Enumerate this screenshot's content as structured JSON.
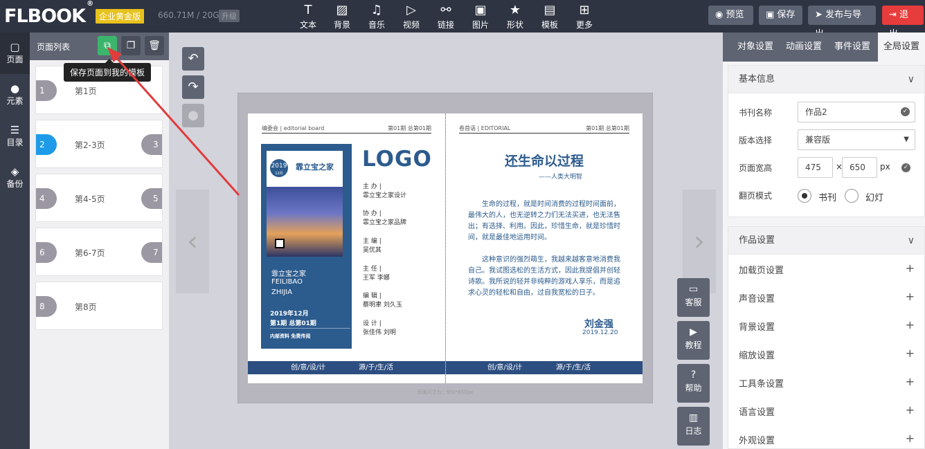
{
  "topbar": {
    "logo": "FLBOOK",
    "logo_mark": "®",
    "edition": "企业黄金版",
    "storage": "660.71M / 20G",
    "upgrade": "升级",
    "tools": [
      {
        "label": "文本",
        "icon": "text-icon",
        "glyph": "T"
      },
      {
        "label": "背景",
        "icon": "background-icon",
        "glyph": "▨"
      },
      {
        "label": "音乐",
        "icon": "music-icon",
        "glyph": "♫"
      },
      {
        "label": "视频",
        "icon": "video-icon",
        "glyph": "▷"
      },
      {
        "label": "链接",
        "icon": "link-icon",
        "glyph": "⚯"
      },
      {
        "label": "图片",
        "icon": "image-icon",
        "glyph": "▣"
      },
      {
        "label": "形状",
        "icon": "star-icon",
        "glyph": "★"
      },
      {
        "label": "模板",
        "icon": "template-icon",
        "glyph": "▤"
      },
      {
        "label": "更多",
        "icon": "more-icon",
        "glyph": "⊞"
      }
    ],
    "preview": "预览",
    "save": "保存",
    "publish": "发布与导出",
    "logout": "退出"
  },
  "leftnav": [
    {
      "label": "页面",
      "icon": "page-icon",
      "glyph": "▢"
    },
    {
      "label": "元素",
      "icon": "element-icon",
      "glyph": "●"
    },
    {
      "label": "目录",
      "icon": "catalog-icon",
      "glyph": "☰"
    },
    {
      "label": "备份",
      "icon": "backup-icon",
      "glyph": "◈"
    }
  ],
  "pagelist": {
    "title": "页面列表",
    "tooltip": "保存页面到我的模板",
    "pages": [
      {
        "label": "第1页",
        "left": "1",
        "right": ""
      },
      {
        "label": "第2-3页",
        "left": "2",
        "right": "3"
      },
      {
        "label": "第4-5页",
        "left": "4",
        "right": "5"
      },
      {
        "label": "第6-7页",
        "left": "6",
        "right": "7"
      },
      {
        "label": "第8页",
        "left": "8",
        "right": ""
      }
    ]
  },
  "book": {
    "caption": "页面尺寸为：950*650px",
    "left": {
      "head_left": "编委会 | editorial board",
      "head_right": "第01期 总第01期",
      "cover_title": "霏立宝之家",
      "cover_year": "2019",
      "cover_month": "12月",
      "cover_name_cn": "霏立宝之家",
      "cover_name_en1": "FEILIBAO",
      "cover_name_en2": "ZHIJIA",
      "cover_date": "2019年12月",
      "cover_issue": "第1期 总第01期",
      "cover_note": "内部资料 免费传阅",
      "logo": "LOGO",
      "credits": [
        {
          "role": "主 办 |",
          "name": "霏立宝之家设计"
        },
        {
          "role": "协 办 |",
          "name": "霏立宝之家品牌"
        },
        {
          "role": "主 编 |",
          "name": "吴优其"
        },
        {
          "role": "主 任 |",
          "name": "王军  李娜"
        },
        {
          "role": "编 辑 |",
          "name": "蔡明聿  刘久玉"
        },
        {
          "role": "设 计 |",
          "name": "张佳伟  刘明"
        }
      ],
      "band_a": "创/意/设/计",
      "band_b": "源/于/生/活"
    },
    "right": {
      "head_left": "卷首语 | EDITORIAL",
      "head_right": "第01期 总第01期",
      "title": "还生命以过程",
      "byline": "——人类大明智",
      "para1": "生命的过程，就是时间消费的过程时间面前，最伟大的人，也无逆转之力们无法买进，也无法售出；有选择、利用。因此，珍惜生命，就是珍惜时间，就是最佳地运用时间。",
      "para2": "这种意识的强烈萌生，我越来越客意地消费我自己。我试图选松的生活方式，因此我提倡并创轻诗歌。我所说的轻并非纯粹的游戏人享乐，而是追求心灵的轻松和自由，过自我宽松的日子。",
      "author": "刘金强",
      "date": "2019.12.20",
      "band_a": "创/意/设/计",
      "band_b": "源/于/生/活"
    }
  },
  "actions": [
    {
      "label": "客服",
      "icon": "chat-icon",
      "glyph": "▭"
    },
    {
      "label": "教程",
      "icon": "play-icon",
      "glyph": "▶"
    },
    {
      "label": "帮助",
      "icon": "help-icon",
      "glyph": "?"
    },
    {
      "label": "日志",
      "icon": "log-icon",
      "glyph": "▥"
    }
  ],
  "rightpanel": {
    "tabs": [
      "对象设置",
      "动画设置",
      "事件设置",
      "全局设置"
    ],
    "basic_title": "基本信息",
    "name_label": "书刊名称",
    "name_value": "作品2",
    "version_label": "版本选择",
    "version_value": "兼容版",
    "width_label": "页面宽高",
    "width_value": "475",
    "times": "×",
    "height_value": "650",
    "unit": "px",
    "mode_label": "翻页模式",
    "mode_book": "书刊",
    "mode_slide": "幻灯",
    "works_title": "作品设置",
    "items": [
      "加载页设置",
      "声音设置",
      "背景设置",
      "缩放设置",
      "工具条设置",
      "语言设置",
      "外观设置"
    ]
  }
}
